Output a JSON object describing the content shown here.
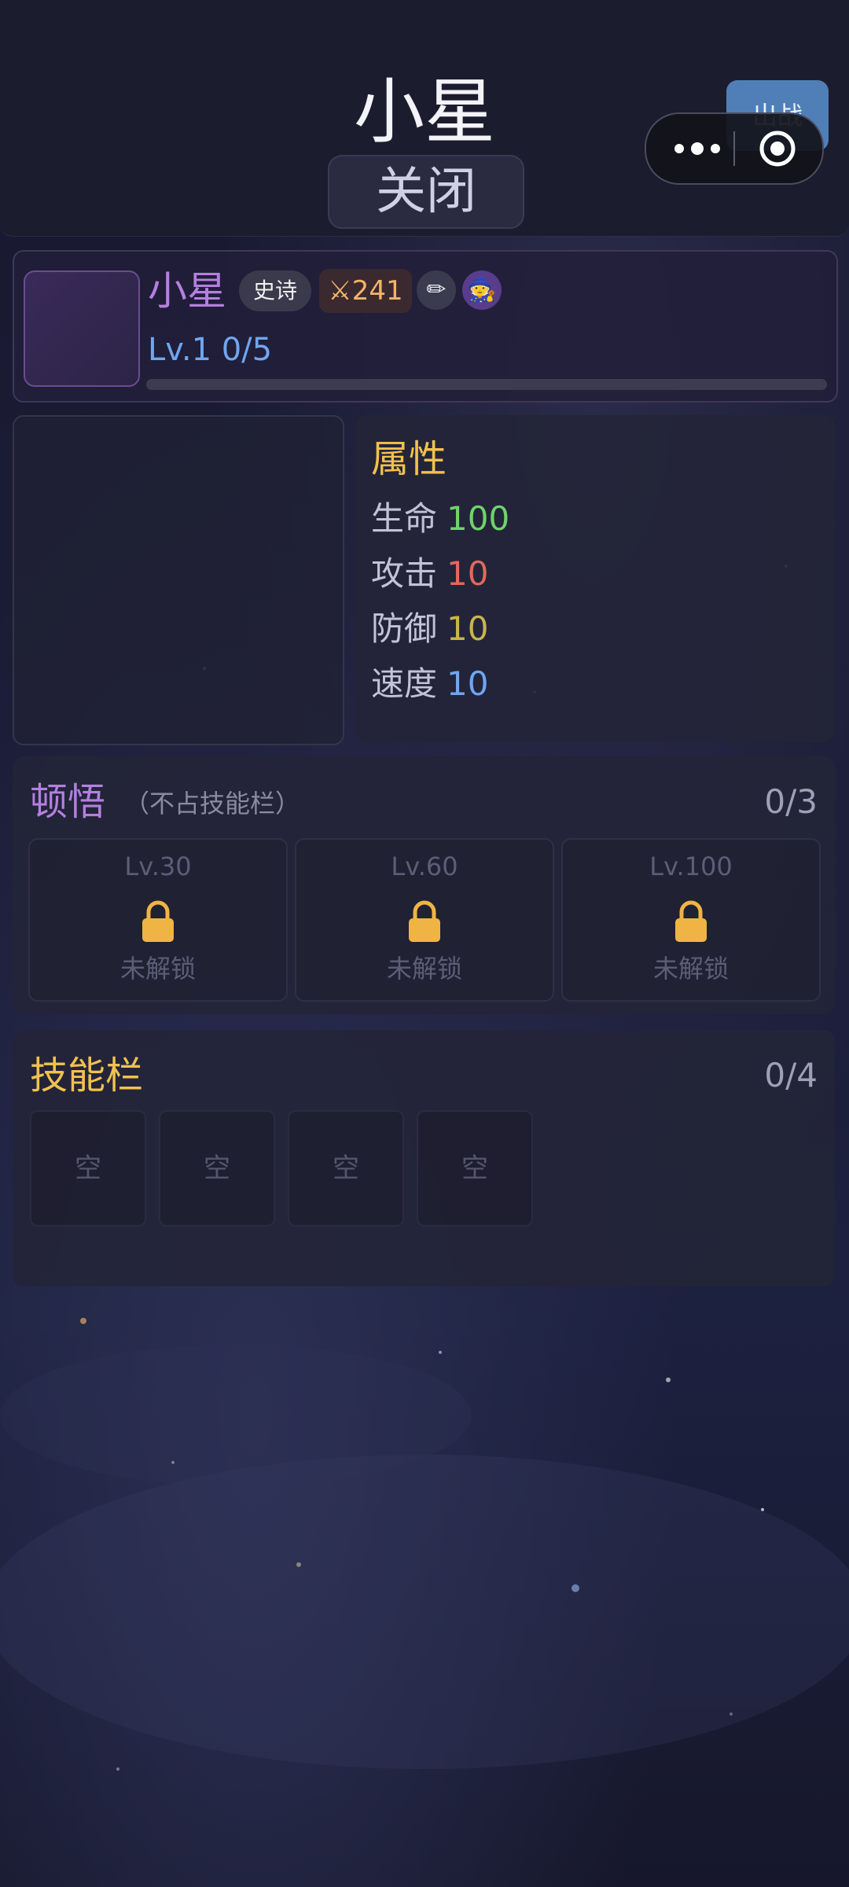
{
  "header": {
    "title": "小星",
    "close_label": "关闭",
    "deploy_label": "出战"
  },
  "character": {
    "name": "小星",
    "rarity": "史诗",
    "power": "241",
    "level_text": "Lv.1 0/5",
    "exp_fraction": 0,
    "icons": [
      "crossed-swords-icon",
      "pencil-icon",
      "mage-icon"
    ]
  },
  "attributes": {
    "title": "属性",
    "rows": [
      {
        "label": "生命",
        "value": "100",
        "color": "#6fd36a"
      },
      {
        "label": "攻击",
        "value": "10",
        "color": "#e0695a"
      },
      {
        "label": "防御",
        "value": "10",
        "color": "#c9b44c"
      },
      {
        "label": "速度",
        "value": "10",
        "color": "#6fa6f0"
      }
    ]
  },
  "enlightenment": {
    "title": "顿悟",
    "subtitle": "（不占技能栏）",
    "count": "0/3",
    "slots": [
      {
        "level": "Lv.30",
        "status": "未解锁"
      },
      {
        "level": "Lv.60",
        "status": "未解锁"
      },
      {
        "level": "Lv.100",
        "status": "未解锁"
      }
    ]
  },
  "skills": {
    "title": "技能栏",
    "count": "0/4",
    "slots": [
      "空",
      "空",
      "空",
      "空"
    ]
  },
  "colors": {
    "accent_purple": "#b57fe0",
    "accent_gold": "#f0c24e",
    "level_blue": "#6fa6f0",
    "deploy_button": "#4f7fb6",
    "lock": "#f0b445"
  }
}
